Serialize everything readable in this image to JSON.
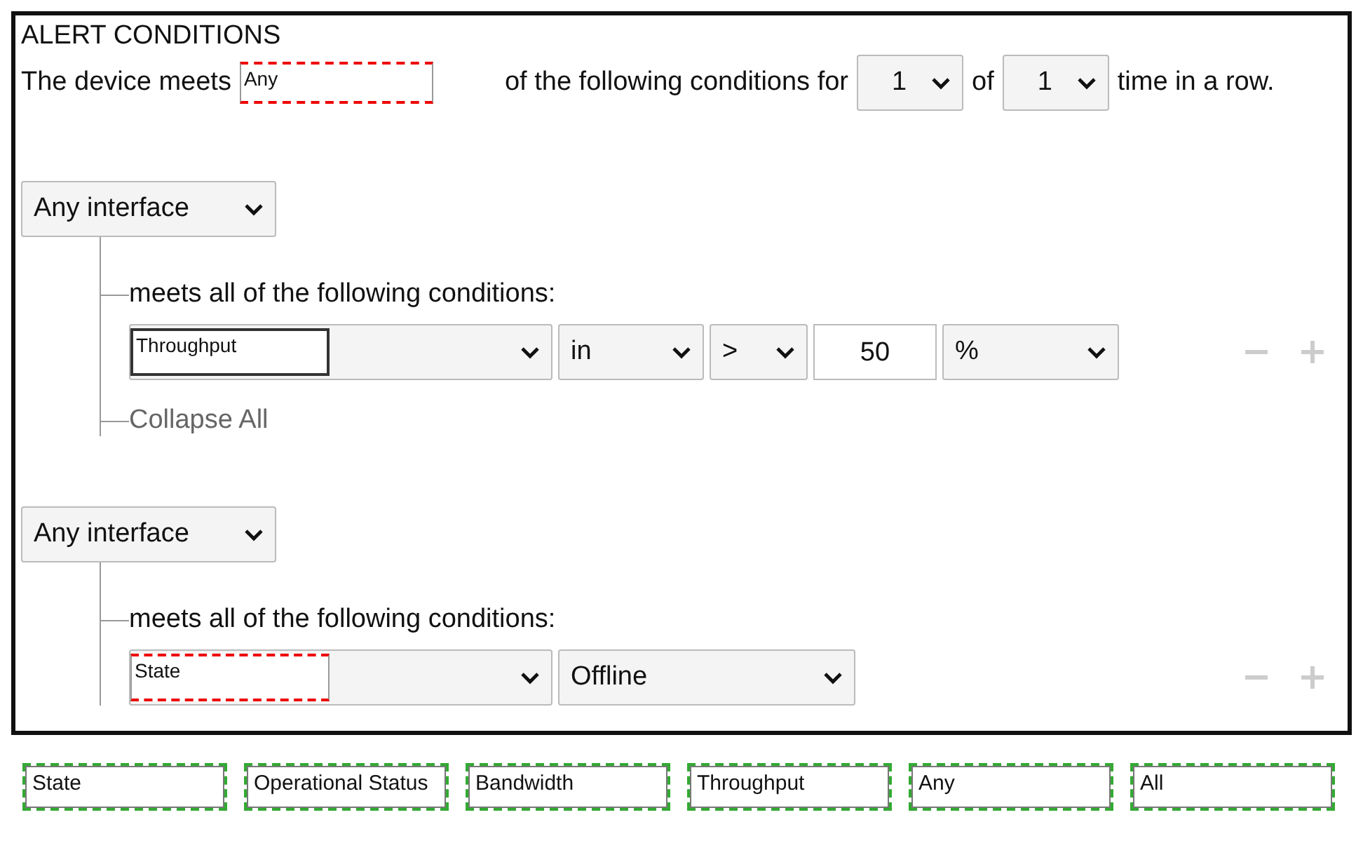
{
  "title": "ALERT CONDITIONS",
  "sentence": {
    "prefix": "The device meets",
    "drop": "Any",
    "middle": "of the following conditions for",
    "count": "1",
    "of": "of",
    "times": "1",
    "suffix": "time in a row."
  },
  "groups": [
    {
      "scope": "Any interface",
      "heading": "meets all of the following conditions:",
      "conditions": [
        {
          "fields": [
            {
              "kind": "metric",
              "value": "Throughput",
              "filled": true
            },
            {
              "kind": "select",
              "value": "in"
            },
            {
              "kind": "select",
              "value": ">"
            },
            {
              "kind": "input",
              "value": "50"
            },
            {
              "kind": "select",
              "value": "%"
            }
          ]
        }
      ],
      "collapse": "Collapse All"
    },
    {
      "scope": "Any interface",
      "heading": "meets all of the following conditions:",
      "conditions": [
        {
          "fields": [
            {
              "kind": "metric",
              "value": "State",
              "filled": false
            },
            {
              "kind": "select",
              "value": "Offline"
            }
          ]
        }
      ]
    }
  ],
  "tokens": [
    "State",
    "Operational Status",
    "Bandwidth",
    "Throughput",
    "Any",
    "All"
  ]
}
